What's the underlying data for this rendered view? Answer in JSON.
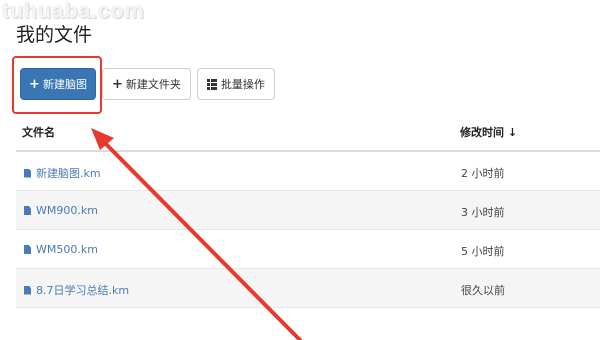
{
  "watermark": "tuhuaba.com",
  "page": {
    "title": "我的文件"
  },
  "toolbar": {
    "new_mindmap": {
      "icon": "plus-icon",
      "icon_glyph": "+",
      "label": "新建脑图"
    },
    "new_folder": {
      "icon": "plus-icon",
      "icon_glyph": "+",
      "label": "新建文件夹"
    },
    "batch": {
      "icon": "grid-list-icon",
      "label": "批量操作"
    }
  },
  "table": {
    "headers": {
      "name": "文件名",
      "time": "修改时间 ↓"
    },
    "rows": [
      {
        "name": "新建脑图.km",
        "time": "2 小时前"
      },
      {
        "name": "WM900.km",
        "time": "3 小时前"
      },
      {
        "name": "WM500.km",
        "time": "5 小时前"
      },
      {
        "name": "8.7日学习总结.km",
        "time": "很久以前"
      }
    ]
  },
  "colors": {
    "primary": "#3a76b3",
    "link": "#4a7bb2",
    "annotation": "#e8392e"
  }
}
